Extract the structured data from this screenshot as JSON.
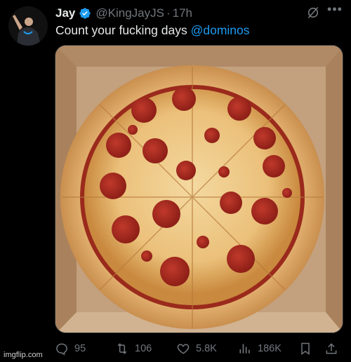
{
  "tweet": {
    "author_name": "Jay",
    "handle": "@KingJayJS",
    "separator": "·",
    "time": "17h",
    "text_prefix": "Count your fucking days ",
    "mention": "@dominos",
    "verified": true
  },
  "media": {
    "description_icon": "pizza-photo",
    "slices": 8,
    "pepperoni_count": 21
  },
  "actions": {
    "replies": "95",
    "retweets": "106",
    "likes": "5.8K",
    "views": "186K"
  },
  "watermark": "imgflip.com",
  "colors": {
    "background": "#000000",
    "text": "#e7e9ea",
    "muted": "#71767b",
    "accent": "#1d9bf0"
  }
}
